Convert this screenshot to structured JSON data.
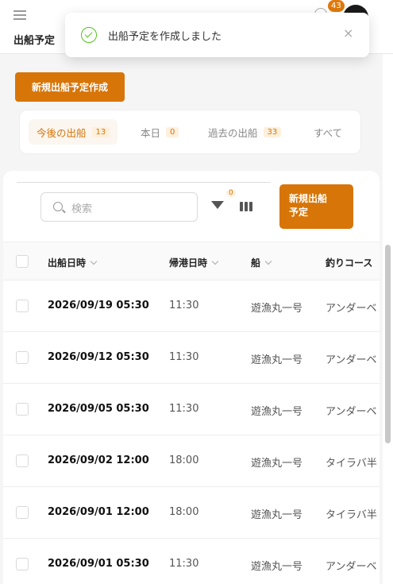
{
  "header": {
    "page_title": "出船予定",
    "notification_count": "43"
  },
  "toast": {
    "message": "出船予定を作成しました",
    "close": "×"
  },
  "actions": {
    "new_schedule": "新規出船予定作成"
  },
  "tabs": [
    {
      "label": "今後の出船",
      "count": "13"
    },
    {
      "label": "本日",
      "count": "0"
    },
    {
      "label": "過去の出船",
      "count": "33"
    },
    {
      "label": "すべて",
      "count": ""
    }
  ],
  "toolbar": {
    "search_placeholder": "検索",
    "filter_count": "0",
    "create_label_line1": "新規出船",
    "create_label_line2": "予定"
  },
  "table": {
    "columns": [
      "出船日時",
      "帰港日時",
      "船",
      "釣りコース"
    ],
    "rows": [
      {
        "departure": "2026/09/19 05:30",
        "return": "11:30",
        "boat": "遊漁丸一号",
        "course": "アンダーベ"
      },
      {
        "departure": "2026/09/12 05:30",
        "return": "11:30",
        "boat": "遊漁丸一号",
        "course": "アンダーベ"
      },
      {
        "departure": "2026/09/05 05:30",
        "return": "11:30",
        "boat": "遊漁丸一号",
        "course": "アンダーベ"
      },
      {
        "departure": "2026/09/02 12:00",
        "return": "18:00",
        "boat": "遊漁丸一号",
        "course": "タイラバ半"
      },
      {
        "departure": "2026/09/01 12:00",
        "return": "18:00",
        "boat": "遊漁丸一号",
        "course": "タイラバ半"
      },
      {
        "departure": "2026/09/01 05:30",
        "return": "11:30",
        "boat": "遊漁丸一号",
        "course": "アンダーベ"
      }
    ]
  },
  "colors": {
    "accent": "#d77508",
    "success": "#52c41a"
  }
}
